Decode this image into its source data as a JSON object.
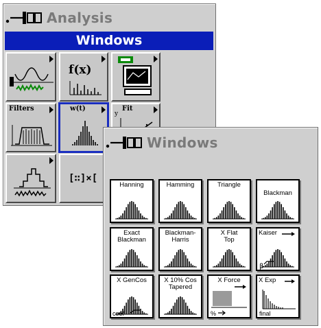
{
  "analysis_palette": {
    "title": "Analysis",
    "subpalette_label": "Windows",
    "tiles": [
      {
        "name": "signal-generation",
        "label": ""
      },
      {
        "name": "math-function",
        "label": "f(x)"
      },
      {
        "name": "measurement",
        "label": ""
      },
      {
        "name": "filters",
        "label": "Filters"
      },
      {
        "name": "windows",
        "label": "w(t)"
      },
      {
        "name": "curve-fit",
        "label": "Fit"
      },
      {
        "name": "probability-statistics",
        "label": ""
      },
      {
        "name": "linear-algebra",
        "label": "[∷]×["
      }
    ]
  },
  "windows_palette": {
    "title": "Windows",
    "items": [
      {
        "name": "hanning",
        "label": "Hanning"
      },
      {
        "name": "hamming",
        "label": "Hamming"
      },
      {
        "name": "triangle",
        "label": "Triangle"
      },
      {
        "name": "blackman",
        "label": "Blackman"
      },
      {
        "name": "exact-blackman",
        "label": "Exact\nBlackman"
      },
      {
        "name": "blackman-harris",
        "label": "Blackman-\nHarris"
      },
      {
        "name": "flat-top",
        "label": "X  Flat\nTop"
      },
      {
        "name": "kaiser-bessel",
        "label": "Kaiser"
      },
      {
        "name": "general-cosine",
        "label": "X GenCos"
      },
      {
        "name": "cosine-tapered",
        "label": "X 10% Cos\nTapered"
      },
      {
        "name": "force",
        "label": "X  Force"
      },
      {
        "name": "exponential",
        "label": "X  Exp"
      }
    ],
    "extra_labels": {
      "coef": "coef",
      "percent": "%",
      "final": "final",
      "beta": "β"
    }
  },
  "colors": {
    "palette_bg": "#cfcfcf",
    "selection_blue": "#0a1eb8",
    "title_gray": "#7a7a7a"
  }
}
